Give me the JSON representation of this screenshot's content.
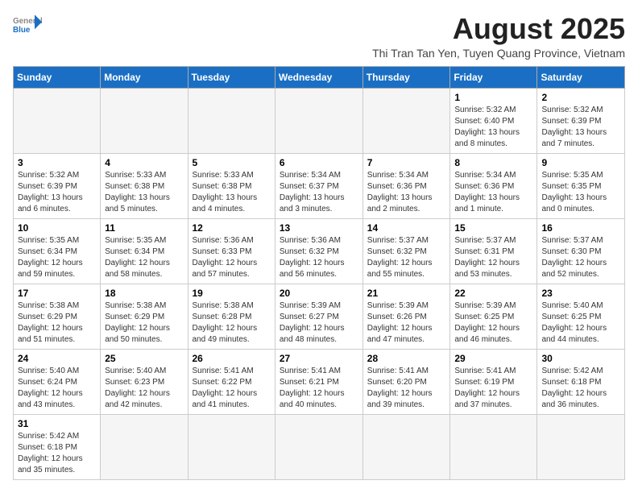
{
  "header": {
    "logo_general": "General",
    "logo_blue": "Blue",
    "month_year": "August 2025",
    "location": "Thi Tran Tan Yen, Tuyen Quang Province, Vietnam"
  },
  "weekdays": [
    "Sunday",
    "Monday",
    "Tuesday",
    "Wednesday",
    "Thursday",
    "Friday",
    "Saturday"
  ],
  "weeks": [
    [
      {
        "day": "",
        "info": ""
      },
      {
        "day": "",
        "info": ""
      },
      {
        "day": "",
        "info": ""
      },
      {
        "day": "",
        "info": ""
      },
      {
        "day": "",
        "info": ""
      },
      {
        "day": "1",
        "info": "Sunrise: 5:32 AM\nSunset: 6:40 PM\nDaylight: 13 hours and 8 minutes."
      },
      {
        "day": "2",
        "info": "Sunrise: 5:32 AM\nSunset: 6:39 PM\nDaylight: 13 hours and 7 minutes."
      }
    ],
    [
      {
        "day": "3",
        "info": "Sunrise: 5:32 AM\nSunset: 6:39 PM\nDaylight: 13 hours and 6 minutes."
      },
      {
        "day": "4",
        "info": "Sunrise: 5:33 AM\nSunset: 6:38 PM\nDaylight: 13 hours and 5 minutes."
      },
      {
        "day": "5",
        "info": "Sunrise: 5:33 AM\nSunset: 6:38 PM\nDaylight: 13 hours and 4 minutes."
      },
      {
        "day": "6",
        "info": "Sunrise: 5:34 AM\nSunset: 6:37 PM\nDaylight: 13 hours and 3 minutes."
      },
      {
        "day": "7",
        "info": "Sunrise: 5:34 AM\nSunset: 6:36 PM\nDaylight: 13 hours and 2 minutes."
      },
      {
        "day": "8",
        "info": "Sunrise: 5:34 AM\nSunset: 6:36 PM\nDaylight: 13 hours and 1 minute."
      },
      {
        "day": "9",
        "info": "Sunrise: 5:35 AM\nSunset: 6:35 PM\nDaylight: 13 hours and 0 minutes."
      }
    ],
    [
      {
        "day": "10",
        "info": "Sunrise: 5:35 AM\nSunset: 6:34 PM\nDaylight: 12 hours and 59 minutes."
      },
      {
        "day": "11",
        "info": "Sunrise: 5:35 AM\nSunset: 6:34 PM\nDaylight: 12 hours and 58 minutes."
      },
      {
        "day": "12",
        "info": "Sunrise: 5:36 AM\nSunset: 6:33 PM\nDaylight: 12 hours and 57 minutes."
      },
      {
        "day": "13",
        "info": "Sunrise: 5:36 AM\nSunset: 6:32 PM\nDaylight: 12 hours and 56 minutes."
      },
      {
        "day": "14",
        "info": "Sunrise: 5:37 AM\nSunset: 6:32 PM\nDaylight: 12 hours and 55 minutes."
      },
      {
        "day": "15",
        "info": "Sunrise: 5:37 AM\nSunset: 6:31 PM\nDaylight: 12 hours and 53 minutes."
      },
      {
        "day": "16",
        "info": "Sunrise: 5:37 AM\nSunset: 6:30 PM\nDaylight: 12 hours and 52 minutes."
      }
    ],
    [
      {
        "day": "17",
        "info": "Sunrise: 5:38 AM\nSunset: 6:29 PM\nDaylight: 12 hours and 51 minutes."
      },
      {
        "day": "18",
        "info": "Sunrise: 5:38 AM\nSunset: 6:29 PM\nDaylight: 12 hours and 50 minutes."
      },
      {
        "day": "19",
        "info": "Sunrise: 5:38 AM\nSunset: 6:28 PM\nDaylight: 12 hours and 49 minutes."
      },
      {
        "day": "20",
        "info": "Sunrise: 5:39 AM\nSunset: 6:27 PM\nDaylight: 12 hours and 48 minutes."
      },
      {
        "day": "21",
        "info": "Sunrise: 5:39 AM\nSunset: 6:26 PM\nDaylight: 12 hours and 47 minutes."
      },
      {
        "day": "22",
        "info": "Sunrise: 5:39 AM\nSunset: 6:25 PM\nDaylight: 12 hours and 46 minutes."
      },
      {
        "day": "23",
        "info": "Sunrise: 5:40 AM\nSunset: 6:25 PM\nDaylight: 12 hours and 44 minutes."
      }
    ],
    [
      {
        "day": "24",
        "info": "Sunrise: 5:40 AM\nSunset: 6:24 PM\nDaylight: 12 hours and 43 minutes."
      },
      {
        "day": "25",
        "info": "Sunrise: 5:40 AM\nSunset: 6:23 PM\nDaylight: 12 hours and 42 minutes."
      },
      {
        "day": "26",
        "info": "Sunrise: 5:41 AM\nSunset: 6:22 PM\nDaylight: 12 hours and 41 minutes."
      },
      {
        "day": "27",
        "info": "Sunrise: 5:41 AM\nSunset: 6:21 PM\nDaylight: 12 hours and 40 minutes."
      },
      {
        "day": "28",
        "info": "Sunrise: 5:41 AM\nSunset: 6:20 PM\nDaylight: 12 hours and 39 minutes."
      },
      {
        "day": "29",
        "info": "Sunrise: 5:41 AM\nSunset: 6:19 PM\nDaylight: 12 hours and 37 minutes."
      },
      {
        "day": "30",
        "info": "Sunrise: 5:42 AM\nSunset: 6:18 PM\nDaylight: 12 hours and 36 minutes."
      }
    ],
    [
      {
        "day": "31",
        "info": "Sunrise: 5:42 AM\nSunset: 6:18 PM\nDaylight: 12 hours and 35 minutes."
      },
      {
        "day": "",
        "info": ""
      },
      {
        "day": "",
        "info": ""
      },
      {
        "day": "",
        "info": ""
      },
      {
        "day": "",
        "info": ""
      },
      {
        "day": "",
        "info": ""
      },
      {
        "day": "",
        "info": ""
      }
    ]
  ]
}
